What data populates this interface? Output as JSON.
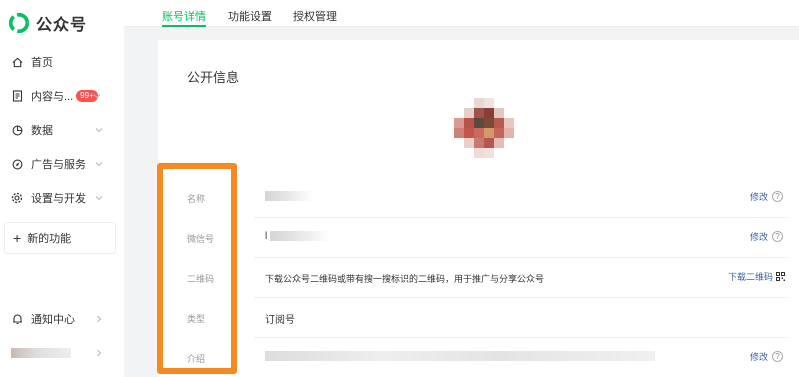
{
  "app": {
    "logo_text": "公众号",
    "brand_color": "#07c160"
  },
  "sidebar": {
    "items": [
      {
        "label": "首页",
        "icon": "home-icon"
      },
      {
        "label": "内容与...",
        "icon": "document-icon",
        "badge": "99+"
      },
      {
        "label": "数据",
        "icon": "chart-icon"
      },
      {
        "label": "广告与服务",
        "icon": "compass-icon"
      },
      {
        "label": "设置与开发",
        "icon": "gear-icon"
      }
    ],
    "new_feature_label": "新的功能",
    "notify_label": "通知中心"
  },
  "tabs": [
    {
      "label": "账号详情",
      "active": true
    },
    {
      "label": "功能设置",
      "active": false
    },
    {
      "label": "授权管理",
      "active": false
    }
  ],
  "main": {
    "section_title": "公开信息",
    "rows": [
      {
        "label": "名称",
        "value": "",
        "action": "修改"
      },
      {
        "label": "微信号",
        "value": "l",
        "action": "修改"
      },
      {
        "label": "二维码",
        "value": "下载公众号二维码或带有搜一搜标识的二维码，用于推广与分享公众号",
        "action": "下载二维码"
      },
      {
        "label": "类型",
        "value": "订阅号",
        "action": ""
      },
      {
        "label": "介绍",
        "value": "",
        "action": "修改"
      }
    ]
  },
  "colors": {
    "highlight": "#f58a22",
    "link": "#3d5fa3",
    "badge": "#fa5151"
  }
}
